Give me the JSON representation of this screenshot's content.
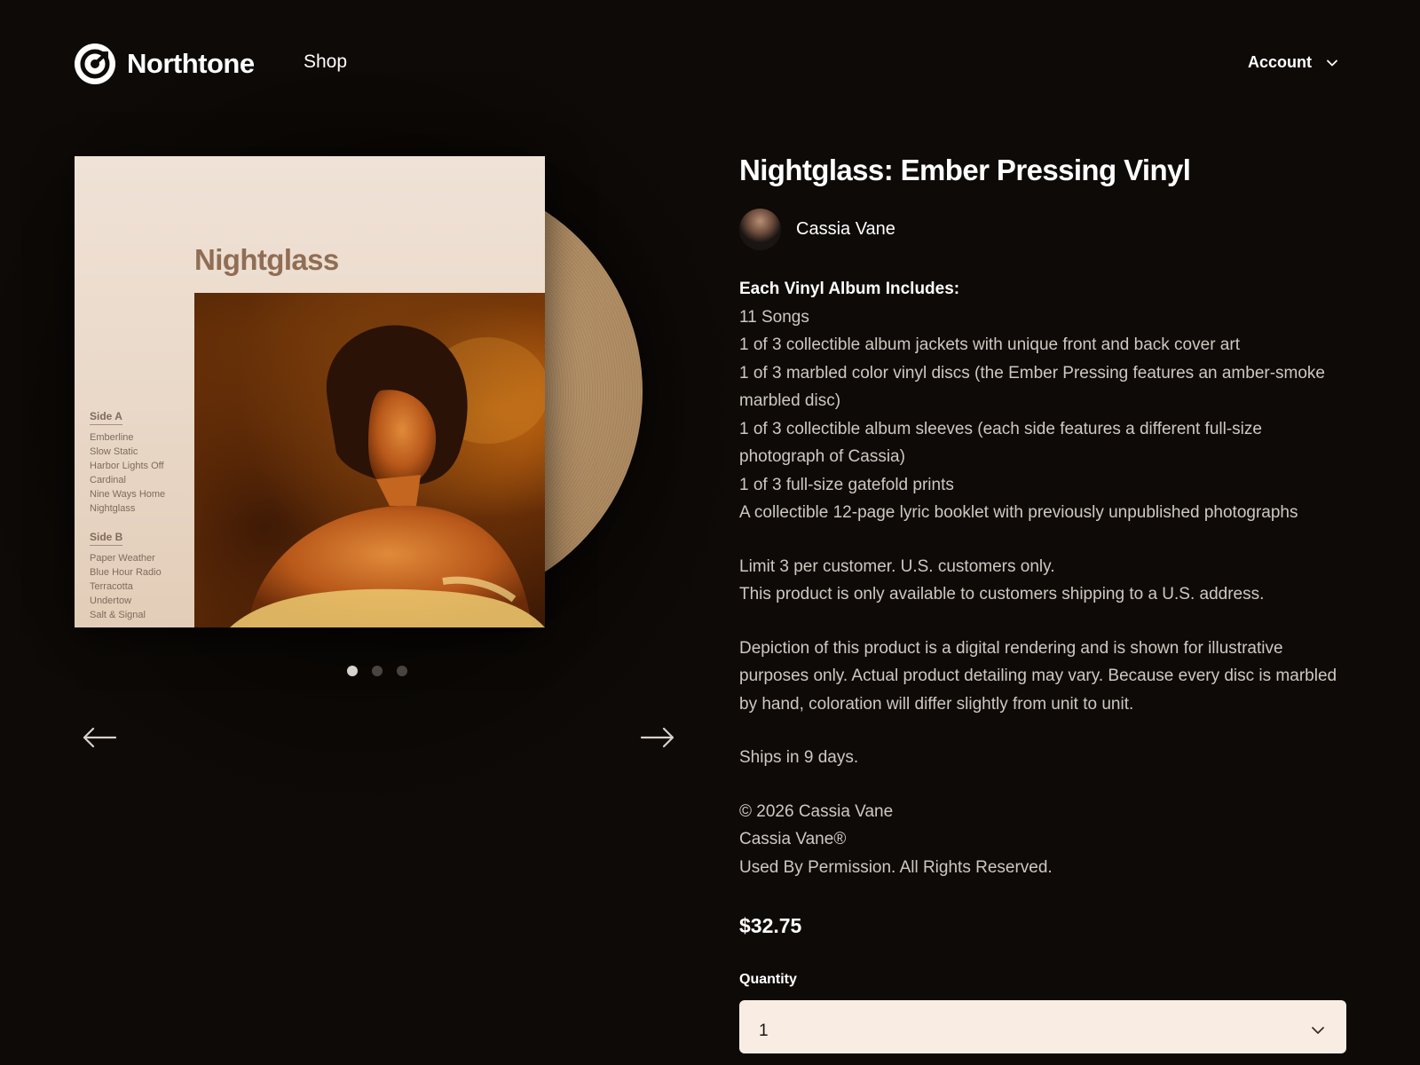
{
  "header": {
    "brand": "Northtone",
    "nav_shop": "Shop",
    "account_label": "Account"
  },
  "gallery": {
    "cover": {
      "title": "Nightglass",
      "side_a_label": "Side A",
      "side_a_tracks": [
        "Emberline",
        "Slow Static",
        "Harbor Lights Off",
        "Cardinal",
        "Nine Ways Home",
        "Nightglass"
      ],
      "side_b_label": "Side B",
      "side_b_tracks": [
        "Paper Weather",
        "Blue Hour Radio",
        "Terracotta",
        "Undertow",
        "Salt & Signal"
      ]
    },
    "slide_count": 3,
    "active_slide": 1
  },
  "product": {
    "title": "Nightglass: Ember Pressing Vinyl",
    "artist": "Cassia Vane",
    "includes_heading": "Each Vinyl Album Includes:",
    "includes": [
      "11 Songs",
      "1 of 3 collectible album jackets with unique front and back cover art",
      "1 of 3 marbled color vinyl discs (the Ember Pressing features an amber-smoke marbled disc)",
      "1 of 3 collectible album sleeves (each side features a different full-size photograph of Cassia)",
      "1 of 3 full-size gatefold prints",
      "A collectible 12-page lyric booklet with previously unpublished photographs"
    ],
    "limit_line": "Limit 3 per customer. U.S. customers only.",
    "shipping_restriction": "This product is only available to customers shipping to a U.S. address.",
    "disclaimer": "Depiction of this product is a digital rendering and is shown for illustrative purposes only. Actual product detailing may vary. Because every disc is marbled by hand, coloration will differ slightly from unit to unit.",
    "ships": "Ships in 9 days.",
    "copyright_1": "© 2026 Cassia Vane",
    "copyright_2": "Cassia Vane®",
    "copyright_3": "Used By Permission. All Rights Reserved.",
    "price": "$32.75",
    "quantity_label": "Quantity",
    "quantity_value": "1"
  },
  "icons": {
    "logo": "northtone-logo-icon",
    "account_chevron": "chevron-down-icon",
    "prev": "arrow-left-icon",
    "next": "arrow-right-icon",
    "quantity_chevron": "chevron-down-icon"
  },
  "colors": {
    "background": "#0e0a07",
    "text_primary": "#ffffff",
    "text_secondary": "#cfc8c1",
    "quantity_field": "#f9ede3",
    "vinyl": "#b08c62"
  }
}
